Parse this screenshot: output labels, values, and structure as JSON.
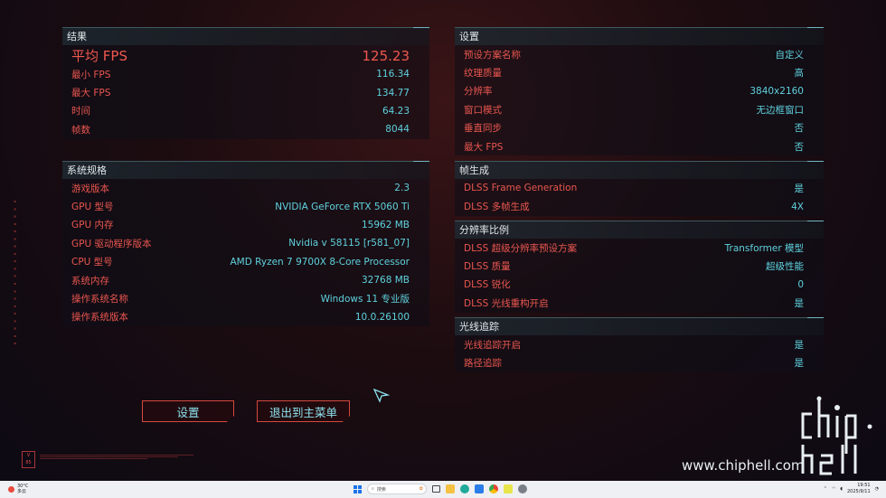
{
  "results": {
    "title": "结果",
    "avg_fps": {
      "label": "平均 FPS",
      "value": "125.23"
    },
    "rows": [
      {
        "label": "最小 FPS",
        "value": "116.34"
      },
      {
        "label": "最大 FPS",
        "value": "134.77"
      },
      {
        "label": "时间",
        "value": "64.23"
      },
      {
        "label": "帧数",
        "value": "8044"
      }
    ]
  },
  "system": {
    "title": "系统规格",
    "rows": [
      {
        "label": "游戏版本",
        "value": "2.3"
      },
      {
        "label": "GPU 型号",
        "value": "NVIDIA GeForce RTX 5060 Ti"
      },
      {
        "label": "GPU 内存",
        "value": "15962 MB"
      },
      {
        "label": "GPU 驱动程序版本",
        "value": "Nvidia v 58115 [r581_07]"
      },
      {
        "label": "CPU 型号",
        "value": "AMD Ryzen 7 9700X 8-Core Processor"
      },
      {
        "label": "系统内存",
        "value": "32768 MB"
      },
      {
        "label": "操作系统名称",
        "value": "Windows 11 专业版"
      },
      {
        "label": "操作系统版本",
        "value": "10.0.26100"
      }
    ]
  },
  "settings": {
    "title": "设置",
    "rows": [
      {
        "label": "预设方案名称",
        "value": "自定义"
      },
      {
        "label": "纹理质量",
        "value": "高"
      },
      {
        "label": "分辨率",
        "value": "3840x2160"
      },
      {
        "label": "窗口模式",
        "value": "无边框窗口"
      },
      {
        "label": "垂直同步",
        "value": "否"
      },
      {
        "label": "最大 FPS",
        "value": "否"
      }
    ]
  },
  "frame_gen": {
    "title": "帧生成",
    "rows": [
      {
        "label": "DLSS Frame Generation",
        "value": "是"
      },
      {
        "label": "DLSS 多帧生成",
        "value": "4X"
      }
    ]
  },
  "resolution_scaling": {
    "title": "分辨率比例",
    "rows": [
      {
        "label": "DLSS 超级分辨率预设方案",
        "value": "Transformer 模型"
      },
      {
        "label": "DLSS 质量",
        "value": "超级性能"
      },
      {
        "label": "DLSS 锐化",
        "value": "0"
      },
      {
        "label": "DLSS 光线重构开启",
        "value": "是"
      }
    ]
  },
  "ray_tracing": {
    "title": "光线追踪",
    "rows": [
      {
        "label": "光线追踪开启",
        "value": "是"
      },
      {
        "label": "路径追踪",
        "value": "是"
      }
    ]
  },
  "buttons": {
    "settings": "设置",
    "exit": "退出到主菜单"
  },
  "watermark": {
    "url": "www.chiphell.com",
    "logo": "chip hell"
  },
  "taskbar": {
    "temp": "30°C",
    "weather": "多云",
    "search_placeholder": "搜索",
    "time": "19:51",
    "date": "2025/9/11"
  },
  "colors": {
    "label_red": "#e9564f",
    "value_cyan": "#5fd2de",
    "header_text": "#dfe6e8"
  }
}
